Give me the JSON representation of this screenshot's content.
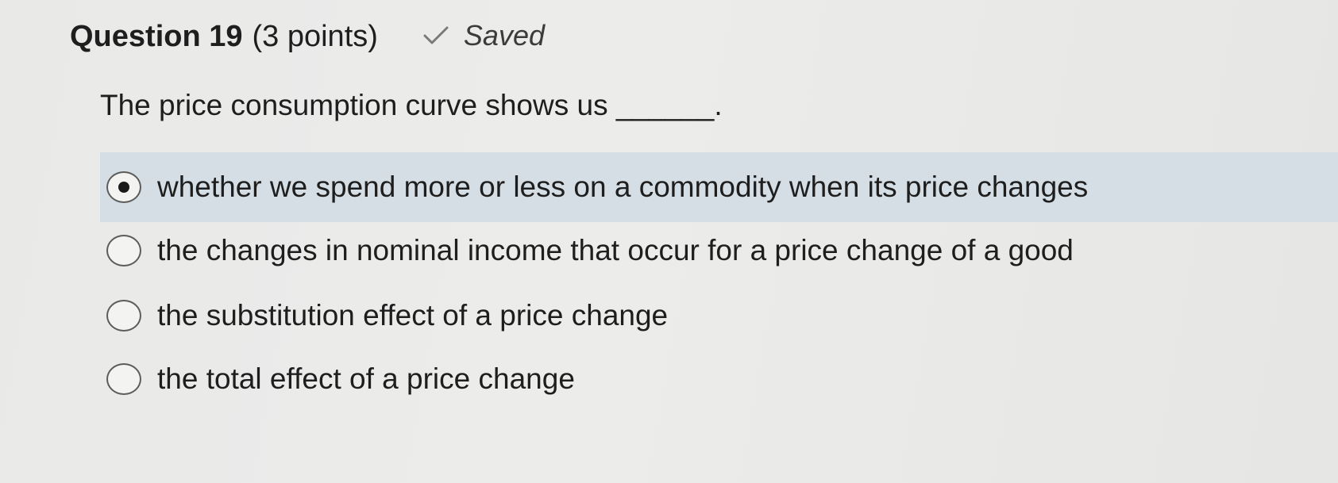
{
  "question": {
    "title": "Question 19",
    "points": "(3 points)",
    "status": {
      "icon": "check-icon",
      "label": "Saved"
    },
    "prompt": "The price consumption curve shows us ______.",
    "options": [
      {
        "label": "whether we spend more or less on a commodity when its price changes",
        "selected": true
      },
      {
        "label": "the changes in nominal income that occur for a price change of a good",
        "selected": false
      },
      {
        "label": "the substitution effect of a price change",
        "selected": false
      },
      {
        "label": "the total effect of a price change",
        "selected": false
      }
    ]
  },
  "colors": {
    "selected_background": "#d5dee4",
    "text": "#1e1e1e"
  }
}
